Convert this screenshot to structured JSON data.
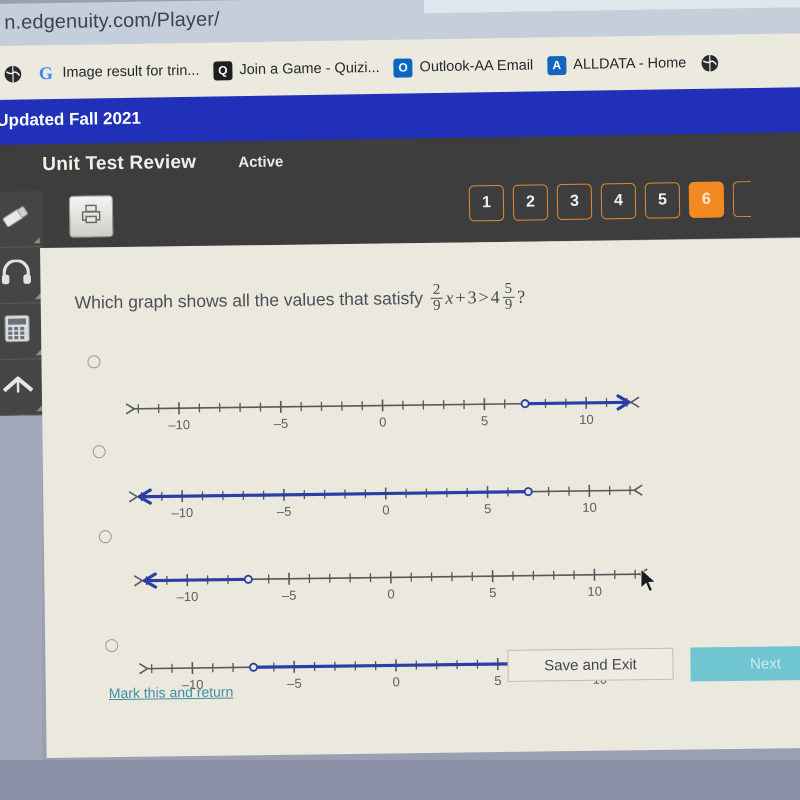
{
  "browser": {
    "url": "n.edgenuity.com/Player/",
    "bookmarks": [
      {
        "label": "",
        "icon": "globe-icon",
        "icon_bg": "#2b2b2b"
      },
      {
        "label": "Image result for trin...",
        "icon": "google-icon",
        "icon_bg": ""
      },
      {
        "label": "Join a Game - Quizi...",
        "icon": "quizizz-icon",
        "icon_bg": "#1f1f1f"
      },
      {
        "label": "Outlook-AA Email",
        "icon": "outlook-icon",
        "icon_bg": "#0a66c2"
      },
      {
        "label": "ALLDATA - Home",
        "icon": "alldata-icon",
        "icon_bg": "#1565c0"
      },
      {
        "label": "",
        "icon": "globe-icon",
        "icon_bg": "#2b2b2b"
      }
    ]
  },
  "banner": {
    "text": "Updated Fall 2021",
    "color": "#2130b8"
  },
  "header": {
    "title": "Unit Test Review",
    "status": "Active",
    "print_icon": "printer-icon",
    "question_buttons": [
      {
        "label": "1",
        "active": false
      },
      {
        "label": "2",
        "active": false
      },
      {
        "label": "3",
        "active": false
      },
      {
        "label": "4",
        "active": false
      },
      {
        "label": "5",
        "active": false
      },
      {
        "label": "6",
        "active": true
      },
      {
        "label": "",
        "active": false
      }
    ],
    "accent_color": "#f28a21"
  },
  "toolrail": [
    {
      "name": "highlighter-icon"
    },
    {
      "name": "headphones-icon"
    },
    {
      "name": "calculator-icon"
    },
    {
      "name": "collapse-arrow-icon"
    }
  ],
  "question": {
    "prompt": "Which graph shows all the values that satisfy",
    "math": {
      "frac1_num": "2",
      "frac1_den": "9",
      "variable": "x",
      "plus": "+",
      "constant": "3",
      "relation": ">",
      "whole": "4",
      "frac2_num": "5",
      "frac2_den": "9",
      "qmark": "?"
    }
  },
  "chart_data": {
    "type": "line",
    "title": "Number line answer options for (2/9)x + 3 > 4 5/9",
    "xlabel": "",
    "ylabel": "",
    "xlim": [
      -12.5,
      12.5
    ],
    "tick_labels": [
      "-10",
      "-5",
      "0",
      "5",
      "10"
    ],
    "tick_values": [
      -10,
      -5,
      0,
      5,
      10
    ],
    "minor_tick_step": 1,
    "grid": false,
    "line_color": "#2b3ea8",
    "axis_color": "#55585c",
    "options": [
      {
        "id": "A",
        "endpoint": 7,
        "endpoint_type": "open",
        "direction": "right",
        "arrow_end": true,
        "label_values": [
          "-10",
          "-5",
          "0",
          "5",
          "10"
        ]
      },
      {
        "id": "B",
        "endpoint": 7,
        "endpoint_type": "open",
        "direction": "left",
        "arrow_end": true,
        "label_values": [
          "-10",
          "-5",
          "0",
          "5",
          "10"
        ]
      },
      {
        "id": "C",
        "endpoint": -7,
        "endpoint_type": "open",
        "direction": "left",
        "arrow_end": true,
        "label_values": [
          "-10",
          "-5",
          "0",
          "5",
          "10"
        ]
      },
      {
        "id": "D",
        "endpoint": -7,
        "endpoint_type": "open",
        "direction": "right",
        "arrow_end": true,
        "label_values": [
          "-10",
          "-5",
          "0",
          "5",
          "10"
        ]
      }
    ]
  },
  "footer": {
    "mark_link": "Mark this and return",
    "save_label": "Save and Exit",
    "next_label": "Next",
    "next_color": "#6fc6d1"
  }
}
